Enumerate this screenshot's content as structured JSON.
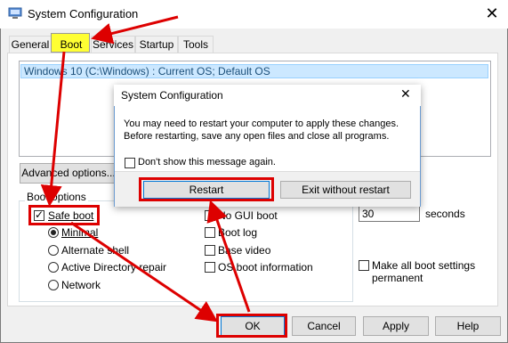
{
  "window": {
    "title": "System Configuration",
    "close_glyph": "✕"
  },
  "tabs": [
    "General",
    "Boot",
    "Services",
    "Startup",
    "Tools"
  ],
  "boot": {
    "os_entries": [
      "Windows 10 (C:\\Windows) : Current OS; Default OS"
    ],
    "advanced_options_label": "Advanced options...",
    "boot_options_label": "Boot options",
    "safe_boot_label": "Safe boot",
    "safe_boot_checked": true,
    "safe_boot_modes": [
      {
        "label": "Minimal",
        "selected": true
      },
      {
        "label": "Alternate shell",
        "selected": false
      },
      {
        "label": "Active Directory repair",
        "selected": false
      },
      {
        "label": "Network",
        "selected": false
      }
    ],
    "extra_options": [
      {
        "label": "No GUI boot",
        "checked": false
      },
      {
        "label": "Boot log",
        "checked": false
      },
      {
        "label": "Base video",
        "checked": false
      },
      {
        "label": "OS boot information",
        "checked": false
      }
    ],
    "timeout_value": "30",
    "timeout_unit": "seconds",
    "make_permanent_label_1": "Make all boot settings",
    "make_permanent_label_2": "permanent"
  },
  "footer": {
    "ok": "OK",
    "cancel": "Cancel",
    "apply": "Apply",
    "help": "Help"
  },
  "dialog": {
    "title": "System Configuration",
    "close_glyph": "✕",
    "message_line_1": "You may need to restart your computer to apply these changes.",
    "message_line_2": "Before restarting, save any open files and close all programs.",
    "dont_show_label": "Don't show this message again.",
    "restart_label": "Restart",
    "exit_label": "Exit without restart"
  },
  "annotation_color": "#dd0000",
  "highlight_color": "#ffff33"
}
